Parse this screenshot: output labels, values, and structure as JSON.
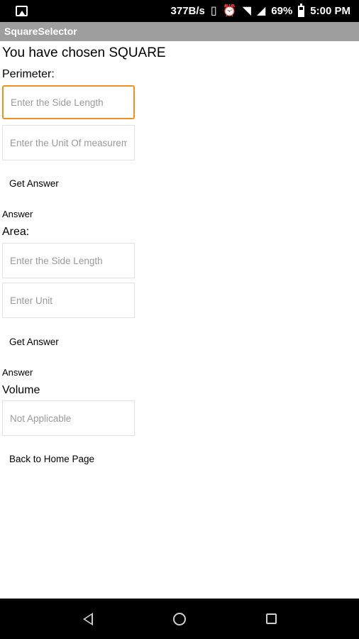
{
  "status_bar": {
    "speed": "377B/s",
    "battery": "69%",
    "time": "5:00 PM"
  },
  "app": {
    "title": "SquareSelector"
  },
  "main": {
    "heading": "You have chosen SQUARE",
    "perimeter": {
      "label": "Perimeter:",
      "side_placeholder": "Enter the Side Length",
      "unit_placeholder": "Enter the Unit Of measurement",
      "button": "Get Answer",
      "answer": "Answer"
    },
    "area": {
      "label": "Area:",
      "side_placeholder": "Enter the Side Length",
      "unit_placeholder": "Enter Unit",
      "button": "Get Answer",
      "answer": "Answer"
    },
    "volume": {
      "label": "Volume",
      "placeholder": "Not Applicable"
    },
    "home_button": "Back to Home Page"
  }
}
